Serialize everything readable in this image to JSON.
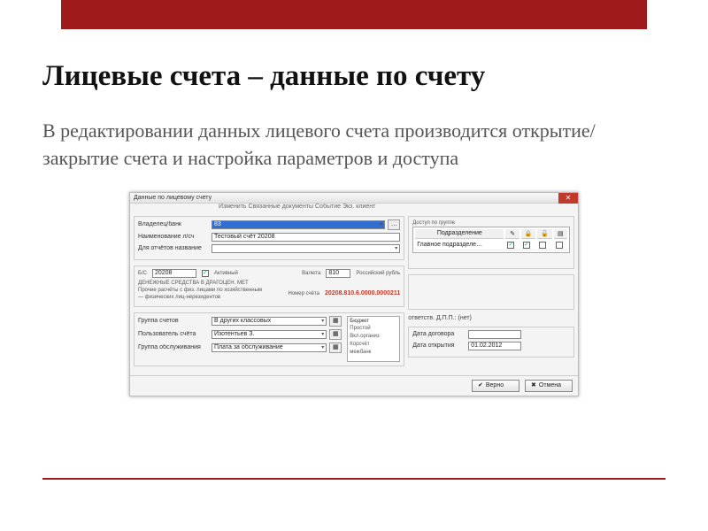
{
  "slide": {
    "title": "Лицевые счета – данные по счету",
    "subtitle": "В редактировании данных лицевого счета производится открытие/закрытие счета и настройка параметров и доступа"
  },
  "win": {
    "title": "Данные по лицевому счету",
    "menu": "Изменить   Связанные документы   Событие   Экз. клиент",
    "close": "✕",
    "labels": {
      "client": "Владелец/банк",
      "name": "Наименование л/сч",
      "report_name": "Для отчётов название",
      "bs": "Б/С",
      "active": "Активный",
      "currency": "Валюта",
      "currency_name": "Российский рубль",
      "section_title": "ДЕНЕЖНЫЕ СРЕДСТВА В ДРАГОЦЕН. МЕТ",
      "section_sub1": "Прочие расчёты с физ. лицами по хозяйственным",
      "section_sub2": "— физических лиц-нерезидентов",
      "acct_no": "Номер счёта",
      "group": "Группа счетов",
      "user": "Пользователь счёта",
      "service": "Группа обслуживания",
      "budget": "Бюджет",
      "contract_date": "Дата договора",
      "open_date": "Дата открытия",
      "perm_title": "Доступ по группе",
      "perm_col": "Подразделение",
      "perm_row": "Главное подразделе…",
      "responsible": "ответств. Д.П.П.: (нет)"
    },
    "values": {
      "client": "83",
      "name": "Тестовый счёт 20208",
      "bs": "20208",
      "currency_code": "810",
      "acct_no": "20208.810.6.0000.0000211",
      "group": "В других классовых",
      "user": "Изотентьев З.",
      "service": "Плата за обслуживание",
      "open_date": "01.02.2012"
    },
    "budget_items": [
      "Простой",
      "Вкл.организ",
      "Корсчёт",
      "межбанк"
    ],
    "buttons": {
      "ok": "Верно",
      "cancel": "Отмена"
    }
  }
}
